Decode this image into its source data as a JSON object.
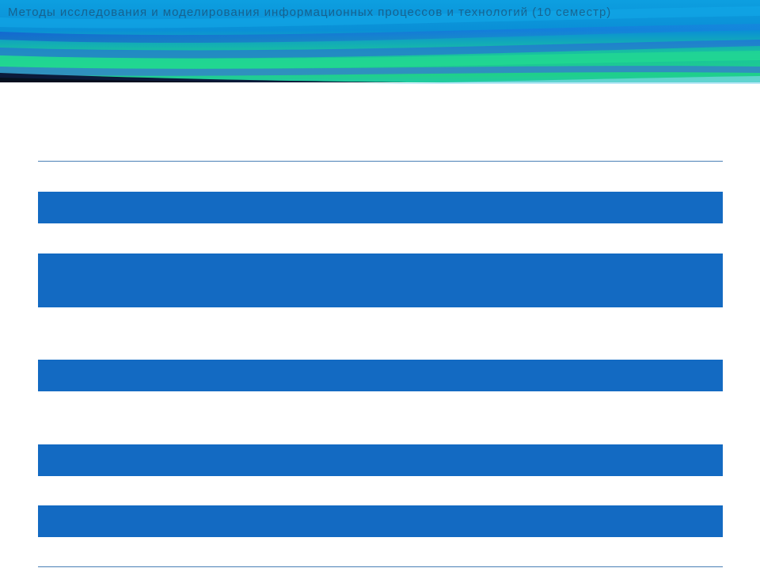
{
  "header": {
    "title": "Методы исследования и моделирования информационных процессов и технологий (10 семестр)"
  },
  "colors": {
    "band": "#136ac2",
    "rule": "#4a7fb5",
    "header_blue": "#0a8fd6",
    "header_green": "#1fd08a"
  },
  "table": {
    "rows": [
      {
        "text": ""
      },
      {
        "text": ""
      },
      {
        "text": ""
      },
      {
        "text": ""
      },
      {
        "text": ""
      },
      {
        "text": ""
      },
      {
        "text": ""
      },
      {
        "text": ""
      },
      {
        "text": ""
      },
      {
        "text": ""
      },
      {
        "text": ""
      }
    ]
  }
}
